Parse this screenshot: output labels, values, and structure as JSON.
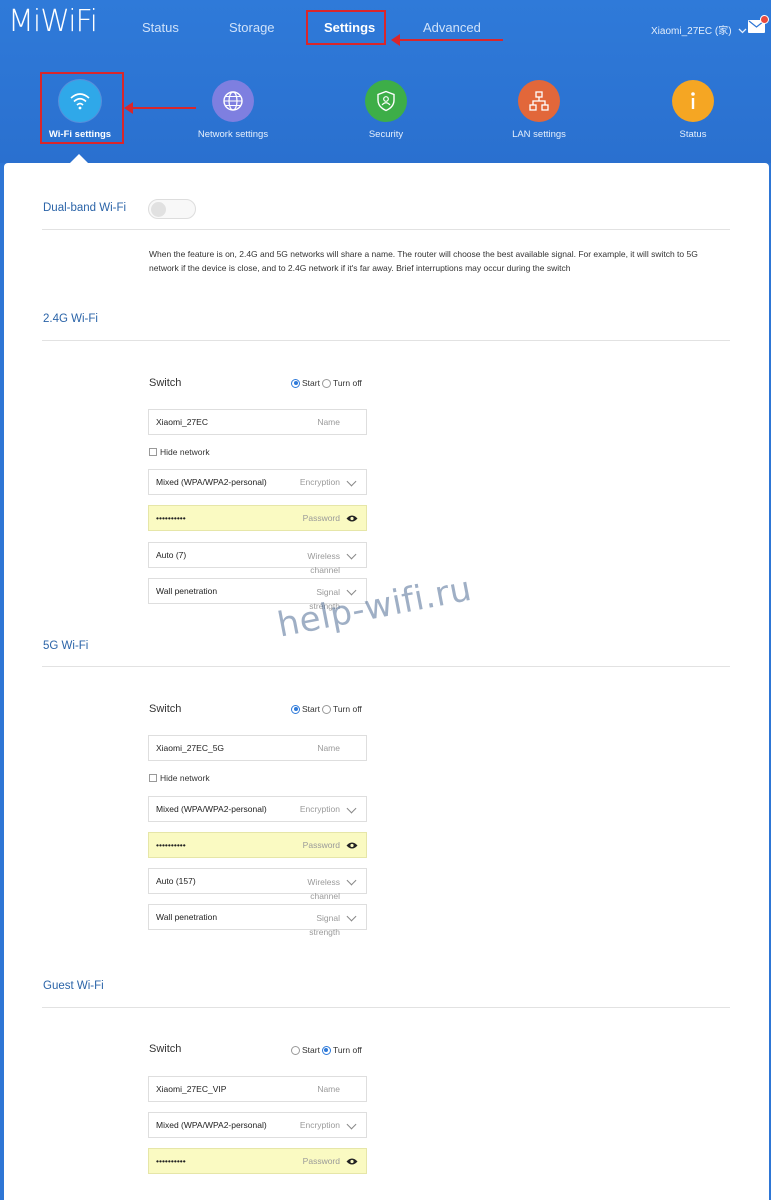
{
  "header": {
    "logo": "MiWiFi",
    "nav": [
      {
        "label": "Status",
        "active": false
      },
      {
        "label": "Storage",
        "active": false
      },
      {
        "label": "Settings",
        "active": true
      },
      {
        "label": "Advanced",
        "active": false
      }
    ],
    "router_name": "Xiaomi_27EC (家)",
    "router_chevron_icon": "chevron-down-icon",
    "mail_icon": "mail-icon"
  },
  "subnav": [
    {
      "label": "Wi-Fi settings",
      "icon": "wifi-icon",
      "color": "#2fa8e9",
      "active": true
    },
    {
      "label": "Network settings",
      "icon": "globe-icon",
      "color": "#7e7fe0",
      "active": false
    },
    {
      "label": "Security",
      "icon": "shield-icon",
      "color": "#3dae48",
      "active": false
    },
    {
      "label": "LAN settings",
      "icon": "network-tree-icon",
      "color": "#e2673a",
      "active": false
    },
    {
      "label": "Status",
      "icon": "info-icon",
      "color": "#f5a623",
      "active": false
    }
  ],
  "dual_band": {
    "title": "Dual-band Wi-Fi",
    "enabled": false,
    "description": "When the feature is on, 2.4G and 5G networks will share a name. The router will choose the best available signal. For example, it will switch to 5G network if the device is close, and to 2.4G network if it's far away. Brief interruptions may occur during the switch"
  },
  "wifi24": {
    "title": "2.4G Wi-Fi",
    "switch_label": "Switch",
    "start_label": "Start",
    "off_label": "Turn off",
    "state": "start",
    "name_value": "Xiaomi_27EC",
    "name_placeholder": "Name",
    "hide_network_label": "Hide network",
    "encryption_value": "Mixed (WPA/WPA2-personal)",
    "encryption_placeholder": "Encryption",
    "password_value": "••••••••••",
    "password_placeholder": "Password",
    "channel_value": "Auto (7)",
    "channel_placeholder": "Wireless channel",
    "signal_value": "Wall penetration",
    "signal_placeholder": "Signal strength"
  },
  "wifi5": {
    "title": "5G Wi-Fi",
    "switch_label": "Switch",
    "start_label": "Start",
    "off_label": "Turn off",
    "state": "start",
    "name_value": "Xiaomi_27EC_5G",
    "name_placeholder": "Name",
    "hide_network_label": "Hide network",
    "encryption_value": "Mixed (WPA/WPA2-personal)",
    "encryption_placeholder": "Encryption",
    "password_value": "••••••••••",
    "password_placeholder": "Password",
    "channel_value": "Auto (157)",
    "channel_placeholder": "Wireless channel",
    "signal_value": "Wall penetration",
    "signal_placeholder": "Signal strength"
  },
  "guest": {
    "title": "Guest Wi-Fi",
    "switch_label": "Switch",
    "start_label": "Start",
    "off_label": "Turn off",
    "state": "off",
    "name_value": "Xiaomi_27EC_VIP",
    "name_placeholder": "Name",
    "encryption_value": "Mixed (WPA/WPA2-personal)",
    "encryption_placeholder": "Encryption",
    "password_value": "••••••••••",
    "password_placeholder": "Password"
  },
  "watermark": "help-wifi.ru",
  "annotation_color": "#d9262b"
}
